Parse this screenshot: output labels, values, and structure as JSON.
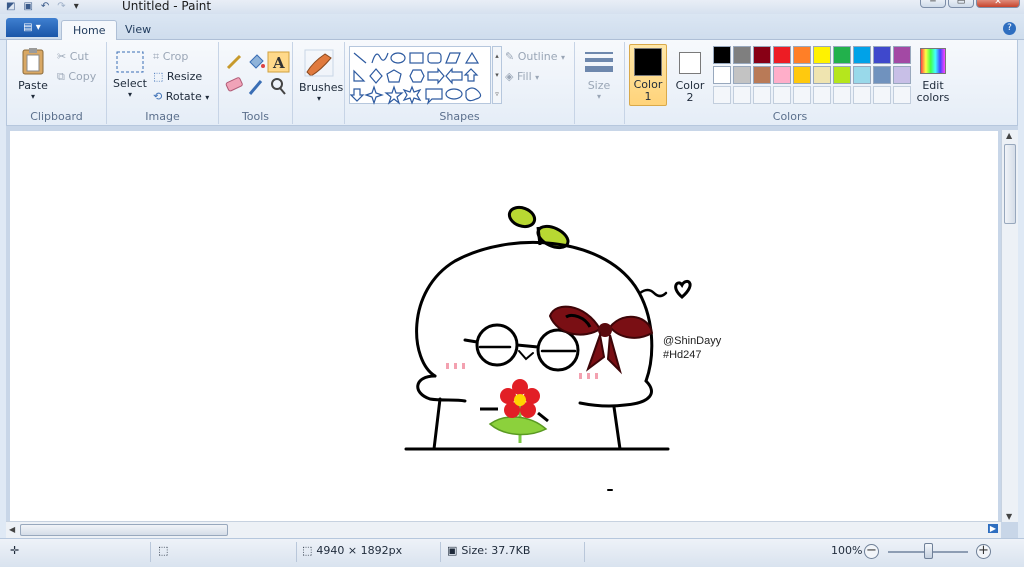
{
  "window": {
    "title": "Untitled - Paint"
  },
  "tabs": {
    "home": "Home",
    "view": "View"
  },
  "clipboard": {
    "paste": "Paste",
    "cut": "Cut",
    "copy": "Copy",
    "group_label": "Clipboard"
  },
  "image": {
    "select": "Select",
    "crop": "Crop",
    "resize": "Resize",
    "rotate": "Rotate",
    "group_label": "Image"
  },
  "tools": {
    "group_label": "Tools"
  },
  "brushes": {
    "label": "Brushes"
  },
  "shapes": {
    "outline": "Outline",
    "fill": "Fill",
    "group_label": "Shapes"
  },
  "size": {
    "label": "Size"
  },
  "colors": {
    "color1_label": "Color",
    "color1_num": "1",
    "color2_label": "Color",
    "color2_num": "2",
    "edit_label": "Edit",
    "edit_label2": "colors",
    "group_label": "Colors",
    "color1_value": "#000000",
    "color2_value": "#ffffff",
    "palette_row1": [
      "#000000",
      "#7f7f7f",
      "#880015",
      "#ed1c24",
      "#ff7f27",
      "#fff200",
      "#22b14c",
      "#00a2e8",
      "#3f48cc",
      "#a349a4"
    ],
    "palette_row2": [
      "#ffffff",
      "#c3c3c3",
      "#b97a57",
      "#ffaec9",
      "#ffc90e",
      "#efe4b0",
      "#b5e61d",
      "#99d9ea",
      "#7092be",
      "#c8bfe7"
    ]
  },
  "canvas": {
    "signature": "@ShinDayy",
    "tag": "#Hd247"
  },
  "status": {
    "dimensions": "4940 × 1892px",
    "size": "Size: 37.7KB",
    "zoom": "100%"
  }
}
